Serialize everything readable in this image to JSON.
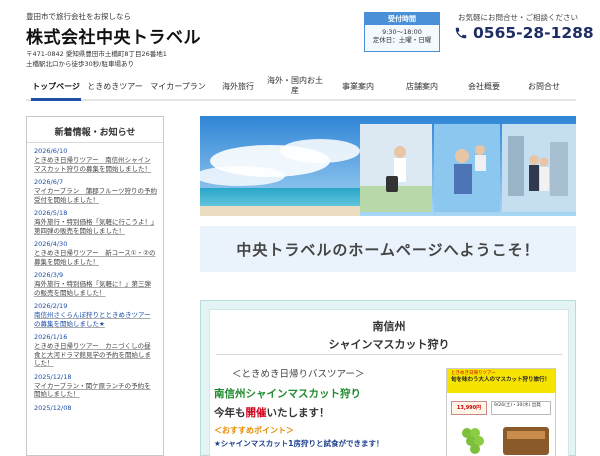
{
  "header": {
    "tagline": "豊田市で旅行会社をお探しなら",
    "company": "株式会社中央トラベル",
    "address_line1": "〒471-0842 愛知県豊田市土橋町8丁目26番地1",
    "address_line2": "土橋駅北口から徒歩30秒/駐車場あり",
    "hours_title": "受付時間",
    "hours_time": "9:30～18:00",
    "hours_closed": "定休日：土曜・日曜",
    "contact_note": "お気軽にお問合せ・ご相談ください",
    "phone": "0565-28-1288",
    "phone_icon": "phone-icon",
    "accent_color": "#4a90d9",
    "brand_color": "#1f2f66"
  },
  "nav": {
    "items": [
      {
        "label": "トップページ"
      },
      {
        "label": "ときめきツアー"
      },
      {
        "label": "マイカープラン"
      },
      {
        "label": "海外旅行"
      },
      {
        "label": "海外・国内お土産"
      },
      {
        "label": "事業案内"
      },
      {
        "label": "店舗案内"
      },
      {
        "label": "会社概要"
      },
      {
        "label": "お問合せ"
      }
    ],
    "active": "トップページ"
  },
  "sidebar": {
    "title": "新着情報・お知らせ",
    "news": [
      {
        "date": "2026/6/10",
        "text": "ときめき日帰りツアー　南信州シャインマスカット狩りの募集を開始しました！"
      },
      {
        "date": "2026/6/7",
        "text": "マイカープラン　蒲郡フルーツ狩りの予約受付を開始しました！"
      },
      {
        "date": "2026/5/18",
        "text": "海外旅行・特別価格「気軽に行こうよ！」第四弾の販売を開始しました！"
      },
      {
        "date": "2026/4/30",
        "text": "ときめき日帰りツアー　新コース①・②の募集を開始しました！"
      },
      {
        "date": "2026/3/9",
        "text": "海外旅行・特別価格「気軽に！」第三弾の販売を開始しました！"
      },
      {
        "date": "2026/2/19",
        "text": "南信州さくらんぼ狩りとときめきツアーの募集を開始しました★",
        "highlight": true
      },
      {
        "date": "2026/1/16",
        "text": "ときめき日帰りツアー　カニづくしの昼食と大河ドラマ館見学の予約を開始しました！"
      },
      {
        "date": "2025/12/18",
        "text": "マイカープラン・関ケ原ランチの予約を開始しました！"
      },
      {
        "date": "2025/12/08",
        "text": ""
      }
    ]
  },
  "main": {
    "welcome": "中央トラベルのホームページへようこそ！",
    "promo": {
      "title_line1": "南信州",
      "title_line2": "シャインマスカット狩り",
      "tour_type": "＜ときめき日帰りバスツアー＞",
      "tour_name": "南信州シャインマスカット狩り",
      "held_prefix": "今年も",
      "held_red": "開催",
      "held_suffix": "いたします！",
      "recommend_heading": "＜おすすめポイント＞",
      "recommend_item": "★シャインマスカット1房狩りと試食ができます！",
      "flyer_small": "ときめき日帰りツアー",
      "flyer_big": "旬を味わう大人のマスカット狩り旅行！",
      "flyer_price": "13,990円",
      "flyer_info": "9/26(土)・30(水) 出発"
    }
  }
}
